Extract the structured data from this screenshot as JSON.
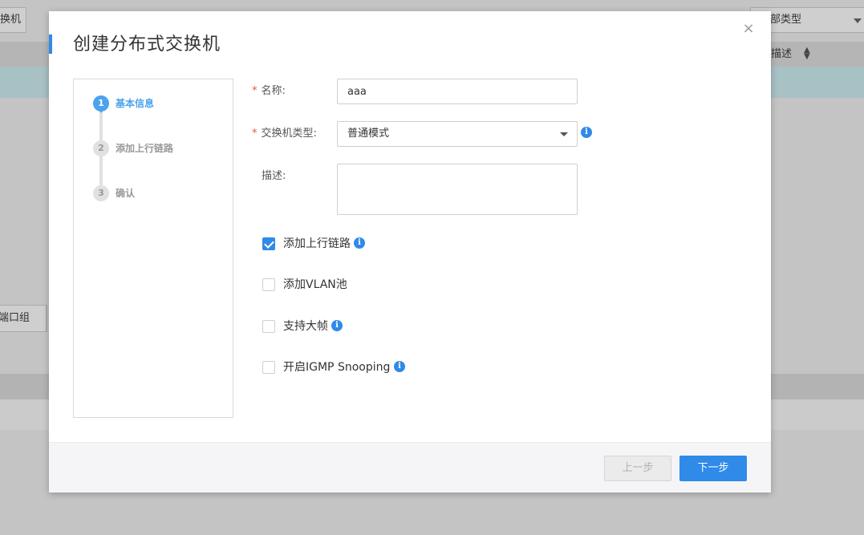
{
  "background": {
    "left_button_label": "换机",
    "type_filter_value": "部类型",
    "table_header_col": "描述",
    "bottom_tab_label": "端口组"
  },
  "dialog": {
    "title": "创建分布式交换机",
    "close_label": "×",
    "steps": [
      {
        "number": "1",
        "label": "基本信息",
        "active": true
      },
      {
        "number": "2",
        "label": "添加上行链路",
        "active": false
      },
      {
        "number": "3",
        "label": "确认",
        "active": false
      }
    ],
    "form": {
      "name_label": "名称:",
      "name_value": "aaa",
      "switch_type_label": "交换机类型:",
      "switch_type_value": "普通模式",
      "description_label": "描述:",
      "description_value": "",
      "required_mark": "*"
    },
    "options": [
      {
        "label": "添加上行链路",
        "checked": true,
        "info": true
      },
      {
        "label": "添加VLAN池",
        "checked": false,
        "info": false
      },
      {
        "label": "支持大帧",
        "checked": false,
        "info": true
      },
      {
        "label": "开启IGMP Snooping",
        "checked": false,
        "info": true
      }
    ],
    "footer": {
      "prev_label": "上一步",
      "next_label": "下一步"
    }
  },
  "colors": {
    "accent": "#2f8ae8",
    "required": "#e9514c",
    "step_active": "#4aa3ec"
  }
}
